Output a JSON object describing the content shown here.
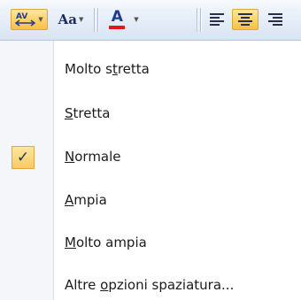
{
  "toolbar": {
    "char_spacing_icon": "character-spacing-icon",
    "change_case_icon": "change-case-icon",
    "change_case_glyph": "Aa",
    "font_color_icon": "font-color-icon",
    "font_color_glyph": "A",
    "font_color_value": "#e8141c",
    "align_left_icon": "align-left-icon",
    "align_center_icon": "align-center-icon",
    "align_right_icon": "align-right-icon",
    "dropdown_glyph": "▼"
  },
  "menu": {
    "check_glyph": "✓",
    "items": [
      {
        "pre": "Molto s",
        "key": "t",
        "post": "retta",
        "checked": false
      },
      {
        "pre": "",
        "key": "S",
        "post": "tretta",
        "checked": false
      },
      {
        "pre": "",
        "key": "N",
        "post": "ormale",
        "checked": true
      },
      {
        "pre": "",
        "key": "A",
        "post": "mpia",
        "checked": false
      },
      {
        "pre": "",
        "key": "M",
        "post": "olto ampia",
        "checked": false
      },
      {
        "pre": "Altre ",
        "key": "o",
        "post": "pzioni spaziatura...",
        "checked": false
      }
    ]
  },
  "colors": {
    "highlight": "#fbd36c",
    "check_bg": "#fdd67a"
  }
}
